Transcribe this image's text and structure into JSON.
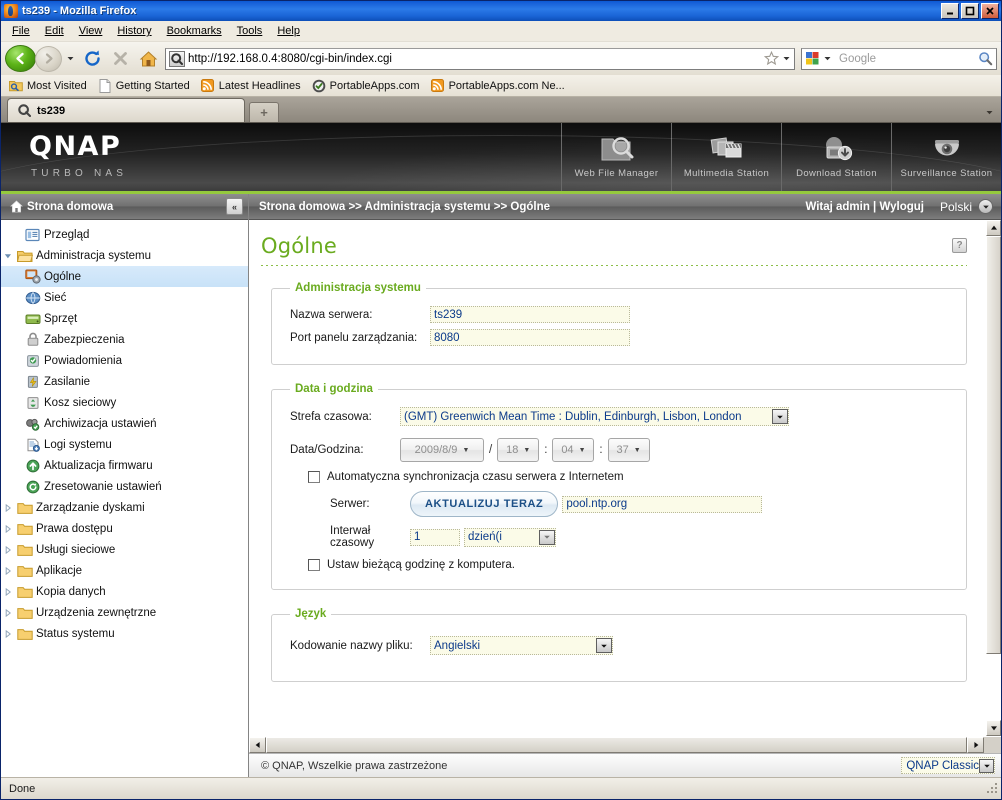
{
  "window": {
    "title": "ts239 - Mozilla Firefox",
    "icon": "firefox-icon",
    "minimize_label": "—",
    "maximize_label": "❐",
    "close_label": "✕"
  },
  "menubar": {
    "items": [
      {
        "label": "File",
        "accel": "F"
      },
      {
        "label": "Edit",
        "accel": "E"
      },
      {
        "label": "View",
        "accel": "V"
      },
      {
        "label": "History",
        "accel": "s"
      },
      {
        "label": "Bookmarks",
        "accel": "B"
      },
      {
        "label": "Tools",
        "accel": "T"
      },
      {
        "label": "Help",
        "accel": "H"
      }
    ]
  },
  "toolbar": {
    "back_icon": "back-arrow-icon",
    "forward_icon": "forward-arrow-icon",
    "history_dropdown_icon": "chevron-down-icon",
    "reload_icon": "reload-icon",
    "stop_icon": "stop-icon",
    "home_icon": "home-icon",
    "url": "http://192.168.0.4:8080/cgi-bin/index.cgi",
    "url_favicon": "qnap-site-icon",
    "bookmark_star_icon": "star-icon",
    "url_dropdown_icon": "chevron-down-icon",
    "search_engine_icon": "google-icon",
    "search_placeholder": "Google",
    "search_value": "",
    "search_icon": "magnifier-icon"
  },
  "bookmarks": {
    "items": [
      {
        "label": "Most Visited",
        "icon": "most-visited-icon"
      },
      {
        "label": "Getting Started",
        "icon": "page-icon"
      },
      {
        "label": "Latest Headlines",
        "icon": "rss-icon"
      },
      {
        "label": "PortableApps.com",
        "icon": "portableapps-icon"
      },
      {
        "label": "PortableApps.com Ne...",
        "icon": "rss-icon"
      }
    ]
  },
  "tabs": {
    "items": [
      {
        "label": "ts239",
        "icon": "qnap-site-icon",
        "active": true
      }
    ],
    "new_tab_label": "+",
    "list_all_tabs_icon": "chevron-down-icon"
  },
  "qnap": {
    "brand": "QNAP",
    "tagline": "TURBO NAS",
    "apps": [
      {
        "label": "Web File Manager",
        "icon": "web-file-manager-icon"
      },
      {
        "label": "Multimedia Station",
        "icon": "multimedia-station-icon"
      },
      {
        "label": "Download Station",
        "icon": "download-station-icon"
      },
      {
        "label": "Surveillance Station",
        "icon": "surveillance-station-icon"
      }
    ],
    "sidebar": {
      "header": "Strona domowa",
      "header_icon": "home-icon",
      "collapse_icon": "double-chevron-left-icon",
      "items": [
        {
          "label": "Przegląd",
          "icon": "overview-icon",
          "level": 1,
          "expandable": false,
          "selected": false
        },
        {
          "label": "Administracja systemu",
          "icon": "open-folder-icon",
          "level": 0,
          "expandable": true,
          "expanded": true,
          "selected": false
        },
        {
          "label": "Ogólne",
          "icon": "general-icon",
          "level": 2,
          "expandable": false,
          "selected": true
        },
        {
          "label": "Sieć",
          "icon": "network-icon",
          "level": 2,
          "expandable": false,
          "selected": false
        },
        {
          "label": "Sprzęt",
          "icon": "hardware-icon",
          "level": 2,
          "expandable": false,
          "selected": false
        },
        {
          "label": "Zabezpieczenia",
          "icon": "security-lock-icon",
          "level": 2,
          "expandable": false,
          "selected": false
        },
        {
          "label": "Powiadomienia",
          "icon": "notification-icon",
          "level": 2,
          "expandable": false,
          "selected": false
        },
        {
          "label": "Zasilanie",
          "icon": "power-icon",
          "level": 2,
          "expandable": false,
          "selected": false
        },
        {
          "label": "Kosz sieciowy",
          "icon": "recycle-bin-icon",
          "level": 2,
          "expandable": false,
          "selected": false
        },
        {
          "label": "Archiwizacja ustawień",
          "icon": "backup-settings-icon",
          "level": 2,
          "expandable": false,
          "selected": false
        },
        {
          "label": "Logi systemu",
          "icon": "system-logs-icon",
          "level": 2,
          "expandable": false,
          "selected": false
        },
        {
          "label": "Aktualizacja firmwaru",
          "icon": "firmware-update-icon",
          "level": 2,
          "expandable": false,
          "selected": false
        },
        {
          "label": "Zresetowanie ustawień",
          "icon": "reset-settings-icon",
          "level": 2,
          "expandable": false,
          "selected": false
        },
        {
          "label": "Zarządzanie dyskami",
          "icon": "folder-icon",
          "level": 0,
          "expandable": true,
          "expanded": false,
          "selected": false
        },
        {
          "label": "Prawa dostępu",
          "icon": "folder-icon",
          "level": 0,
          "expandable": true,
          "expanded": false,
          "selected": false
        },
        {
          "label": "Usługi sieciowe",
          "icon": "folder-icon",
          "level": 0,
          "expandable": true,
          "expanded": false,
          "selected": false
        },
        {
          "label": "Aplikacje",
          "icon": "folder-icon",
          "level": 0,
          "expandable": true,
          "expanded": false,
          "selected": false
        },
        {
          "label": "Kopia danych",
          "icon": "folder-icon",
          "level": 0,
          "expandable": true,
          "expanded": false,
          "selected": false
        },
        {
          "label": "Urządzenia zewnętrzne",
          "icon": "folder-icon",
          "level": 0,
          "expandable": true,
          "expanded": false,
          "selected": false
        },
        {
          "label": "Status systemu",
          "icon": "folder-icon",
          "level": 0,
          "expandable": true,
          "expanded": false,
          "selected": false
        }
      ]
    },
    "breadcrumb": "Strona domowa >> Administracja systemu >> Ogólne",
    "greeting": "Witaj admin | Wyloguj",
    "language": "Polski",
    "language_chevron_icon": "chevron-down-icon",
    "page_title": "Ogólne",
    "help_label": "?",
    "sections": {
      "system_admin": {
        "legend": "Administracja systemu",
        "server_name_label": "Nazwa serwera:",
        "server_name_value": "ts239",
        "port_label": "Port panelu zarządzania:",
        "port_value": "8080"
      },
      "date_time": {
        "legend": "Data i godzina",
        "timezone_label": "Strefa czasowa:",
        "timezone_value": "(GMT) Greenwich Mean Time : Dublin, Edinburgh, Lisbon, London",
        "datetime_label": "Data/Godzina:",
        "date_value": "2009/8/9",
        "hour_value": "18",
        "minute_value": "04",
        "second_value": "37",
        "date_time_separator": "/",
        "time_separator": ":",
        "auto_sync_label": "Automatyczna synchronizacja czasu serwera z Internetem",
        "auto_sync_checked": false,
        "server_label": "Serwer:",
        "update_now_label": "AKTUALIZUJ TERAZ",
        "ntp_server_value": "pool.ntp.org",
        "interval_label": "Interwał czasowy",
        "interval_value": "1",
        "interval_unit": "dzień(i",
        "manual_label": "Ustaw bieżącą godzinę z komputera.",
        "manual_checked": false
      },
      "language": {
        "legend": "Język",
        "encoding_label": "Kodowanie nazwy pliku:",
        "encoding_value": "Angielski"
      }
    },
    "footer": {
      "copyright": "© QNAP, Wszelkie prawa zastrzeżone",
      "theme_value": "QNAP Classic",
      "theme_arrow_icon": "chevron-down-icon"
    }
  },
  "browser_status": {
    "text": "Done"
  },
  "colors": {
    "qnap_green": "#95c93d",
    "title_green": "#6aab1f",
    "titlebar_blue": "#1a64d6",
    "selection_blue": "#c8e2f8",
    "field_yellow": "#fbfbe8",
    "field_text_blue": "#0b3a8a"
  }
}
